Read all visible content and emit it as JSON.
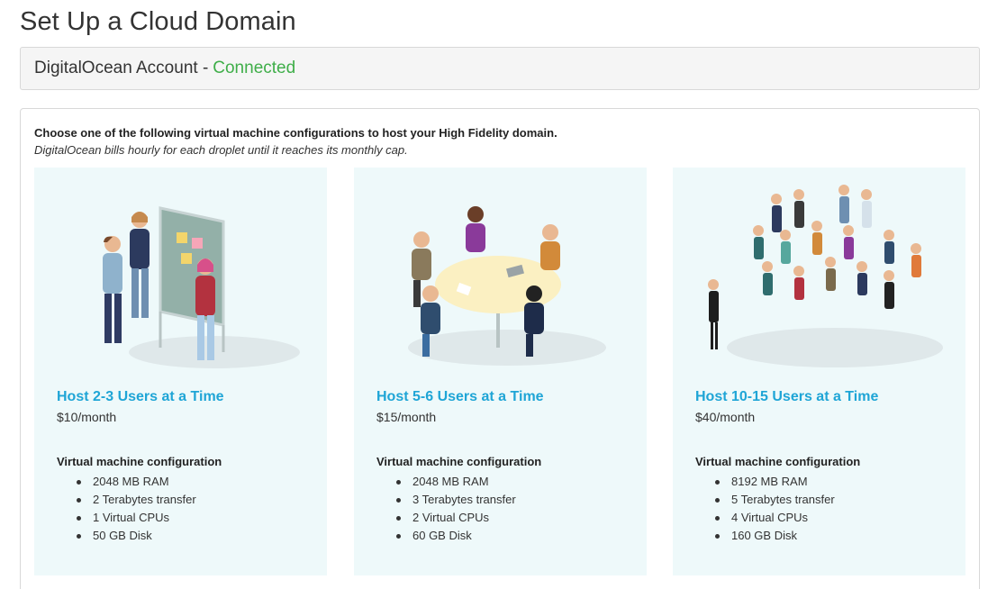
{
  "page": {
    "title": "Set Up a Cloud Domain"
  },
  "account": {
    "label": "DigitalOcean Account - ",
    "status": "Connected",
    "status_color": "#3fae49"
  },
  "intro": {
    "line1": "Choose one of the following virtual machine configurations to host your High Fidelity domain.",
    "line2": "DigitalOcean bills hourly for each droplet until it reaches its monthly cap."
  },
  "accent_color": "#1fa5d6",
  "plans": [
    {
      "title": "Host 2-3 Users at a Time",
      "price": "$10/month",
      "config_label": "Virtual machine configuration",
      "specs": [
        "2048 MB RAM",
        "2 Terabytes transfer",
        "1 Virtual CPUs",
        "50 GB Disk"
      ]
    },
    {
      "title": "Host 5-6 Users at a Time",
      "price": "$15/month",
      "config_label": "Virtual machine configuration",
      "specs": [
        "2048 MB RAM",
        "3 Terabytes transfer",
        "2 Virtual CPUs",
        "60 GB Disk"
      ]
    },
    {
      "title": "Host 10-15 Users at a Time",
      "price": "$40/month",
      "config_label": "Virtual machine configuration",
      "specs": [
        "8192 MB RAM",
        "5 Terabytes transfer",
        "4 Virtual CPUs",
        "160 GB Disk"
      ]
    }
  ]
}
